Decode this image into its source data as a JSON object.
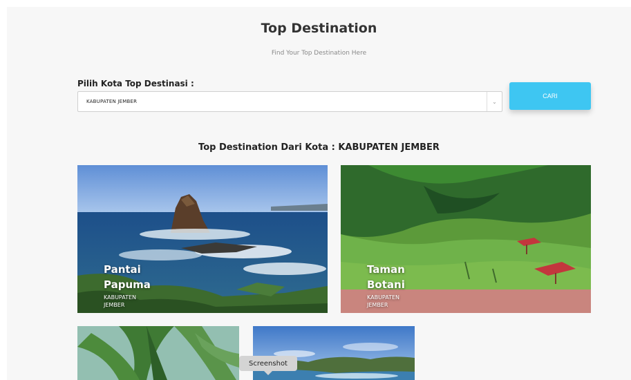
{
  "header": {
    "title": "Top Destination",
    "subtitle": "Find Your Top Destination Here"
  },
  "search": {
    "label": "Pilih Kota Top Destinasi :",
    "selected_city": "KABUPATEN JEMBER",
    "button_label": "CARI"
  },
  "results": {
    "heading": "Top Destination Dari Kota : KABUPATEN JEMBER",
    "destinations": [
      {
        "name": "Pantai Papuma",
        "city": "KABUPATEN JEMBER"
      },
      {
        "name": "Taman Botani",
        "city": "KABUPATEN JEMBER"
      }
    ]
  },
  "tooltip": {
    "label": "Screenshot"
  },
  "colors": {
    "accent": "#3ec6f2",
    "page_background": "#f7f7f7"
  }
}
